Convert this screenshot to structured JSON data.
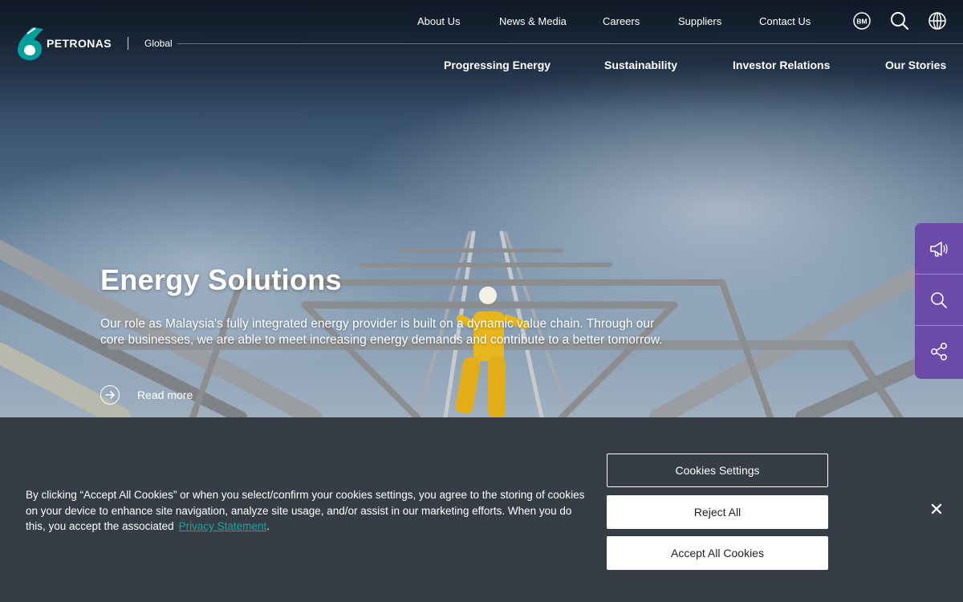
{
  "header": {
    "brand": "PETRONAS",
    "region": "Global",
    "top_nav": [
      "About Us",
      "News & Media",
      "Careers",
      "Suppliers",
      "Contact Us"
    ],
    "language_badge": "BM",
    "main_nav": [
      "Progressing Energy",
      "Sustainability",
      "Investor Relations",
      "Our Stories"
    ]
  },
  "hero": {
    "title": "Energy Solutions",
    "description": "Our role as Malaysia's fully integrated energy provider is built on a dynamic value chain. Through our core businesses, we are able to meet increasing energy demands and contribute to a better tomorrow.",
    "cta_label": "Read more"
  },
  "side_rail": {
    "items": [
      "megaphone-icon",
      "search-icon",
      "share-icon"
    ],
    "color": "#6b4aa8"
  },
  "cookie_banner": {
    "text": "By clicking “Accept All Cookies” or when you select/confirm your cookies settings, you agree to the storing of cookies on your device to enhance site navigation, analyze site usage, and/or assist in our marketing efforts. When you do this, you accept the associated",
    "link_text": "Privacy Statement",
    "link_suffix": ".",
    "settings_label": "Cookies Settings",
    "reject_label": "Reject All",
    "accept_label": "Accept All Cookies",
    "close_glyph": "✕",
    "link_color": "#13a89e"
  }
}
